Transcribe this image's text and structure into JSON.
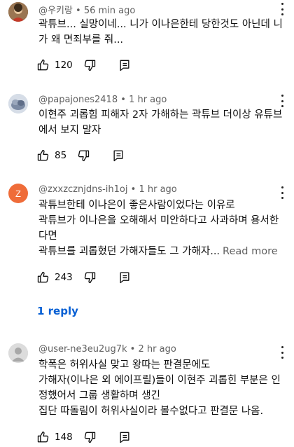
{
  "comments": [
    {
      "author": "@우키랑",
      "time": "56 min ago",
      "lines": [
        "곽튜브... 실망이네... 니가 이나은한테 당한것도 아닌데 니",
        "가 왜 면죄부를 줘..."
      ],
      "likes": "120"
    },
    {
      "author": "@papajones2418",
      "time": "1 hr ago",
      "lines": [
        "이현주 괴롭힘 피해자 2자 가해하는 곽튜브 더이상 유튜브",
        "에서 보지 말자"
      ],
      "likes": "85"
    },
    {
      "author": "@zxxzcznjdns-ih1oj",
      "time": "1 hr ago",
      "avatar_letter": "Z",
      "lines": [
        "곽튜브한테 이나은이 좋은사람이었다는 이유로",
        "곽튜브가 이나은을 오해해서 미안하다고 사과하며 용서한",
        "다면",
        "곽튜브를 괴롭혔던 가해자들도 그 가해자..."
      ],
      "read_more": "Read more",
      "likes": "243",
      "replies": "1 reply"
    },
    {
      "author": "@user-ne3eu2ug7k",
      "time": "2 hr ago",
      "lines": [
        "학폭은 허위사실 맞고 왕따는 판결문에도",
        "가해자(이나은 외 에이프릴)들이 이현주 괴롭힌 부분은 인",
        "정했어서 그룹 생활하며 생긴",
        "집단 따돌림이 허위사실이라 볼수없다고 판결문 나옴."
      ],
      "likes": "148"
    }
  ],
  "icons": {
    "like": "thumbs-up-icon",
    "dislike": "thumbs-down-icon",
    "reply": "reply-icon",
    "menu": "more-vert-icon"
  },
  "colors": {
    "reply_link": "#065fd4",
    "meta_text": "#606060",
    "z_avatar": "#ef6c39"
  }
}
